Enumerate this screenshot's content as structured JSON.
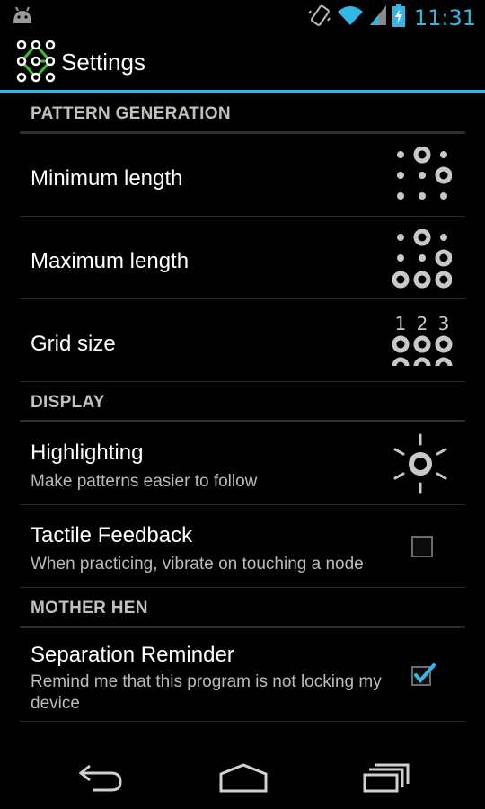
{
  "status_bar": {
    "time": "11:31",
    "icons": [
      "android-debug-icon",
      "vibrate-icon",
      "wifi-icon",
      "signal-icon",
      "battery-charging-icon"
    ]
  },
  "action_bar": {
    "title": "Settings",
    "icon": "pattern-grid-app-icon"
  },
  "colors": {
    "accent": "#33b5e5",
    "background": "#000000",
    "divider": "#2d2d2d",
    "secondary_text": "#bbbbbb"
  },
  "categories": {
    "pattern_generation": "PATTERN GENERATION",
    "display": "DISPLAY",
    "mother_hen": "MOTHER HEN"
  },
  "prefs": {
    "min_length": {
      "title": "Minimum length",
      "icon": "pattern-min-length-icon"
    },
    "max_length": {
      "title": "Maximum length",
      "icon": "pattern-max-length-icon"
    },
    "grid_size": {
      "title": "Grid size",
      "icon": "grid-size-icon",
      "digits": [
        "1",
        "2",
        "3"
      ]
    },
    "highlighting": {
      "title": "Highlighting",
      "summary": "Make patterns easier to follow",
      "icon": "sun-icon"
    },
    "tactile": {
      "title": "Tactile Feedback",
      "summary": "When practicing, vibrate on touching a node",
      "checked": false
    },
    "separation": {
      "title": "Separation Reminder",
      "summary": "Remind me that this program is not locking my device",
      "checked": true
    }
  },
  "nav_bar": {
    "buttons": [
      "back-icon",
      "home-icon",
      "recent-apps-icon"
    ]
  }
}
